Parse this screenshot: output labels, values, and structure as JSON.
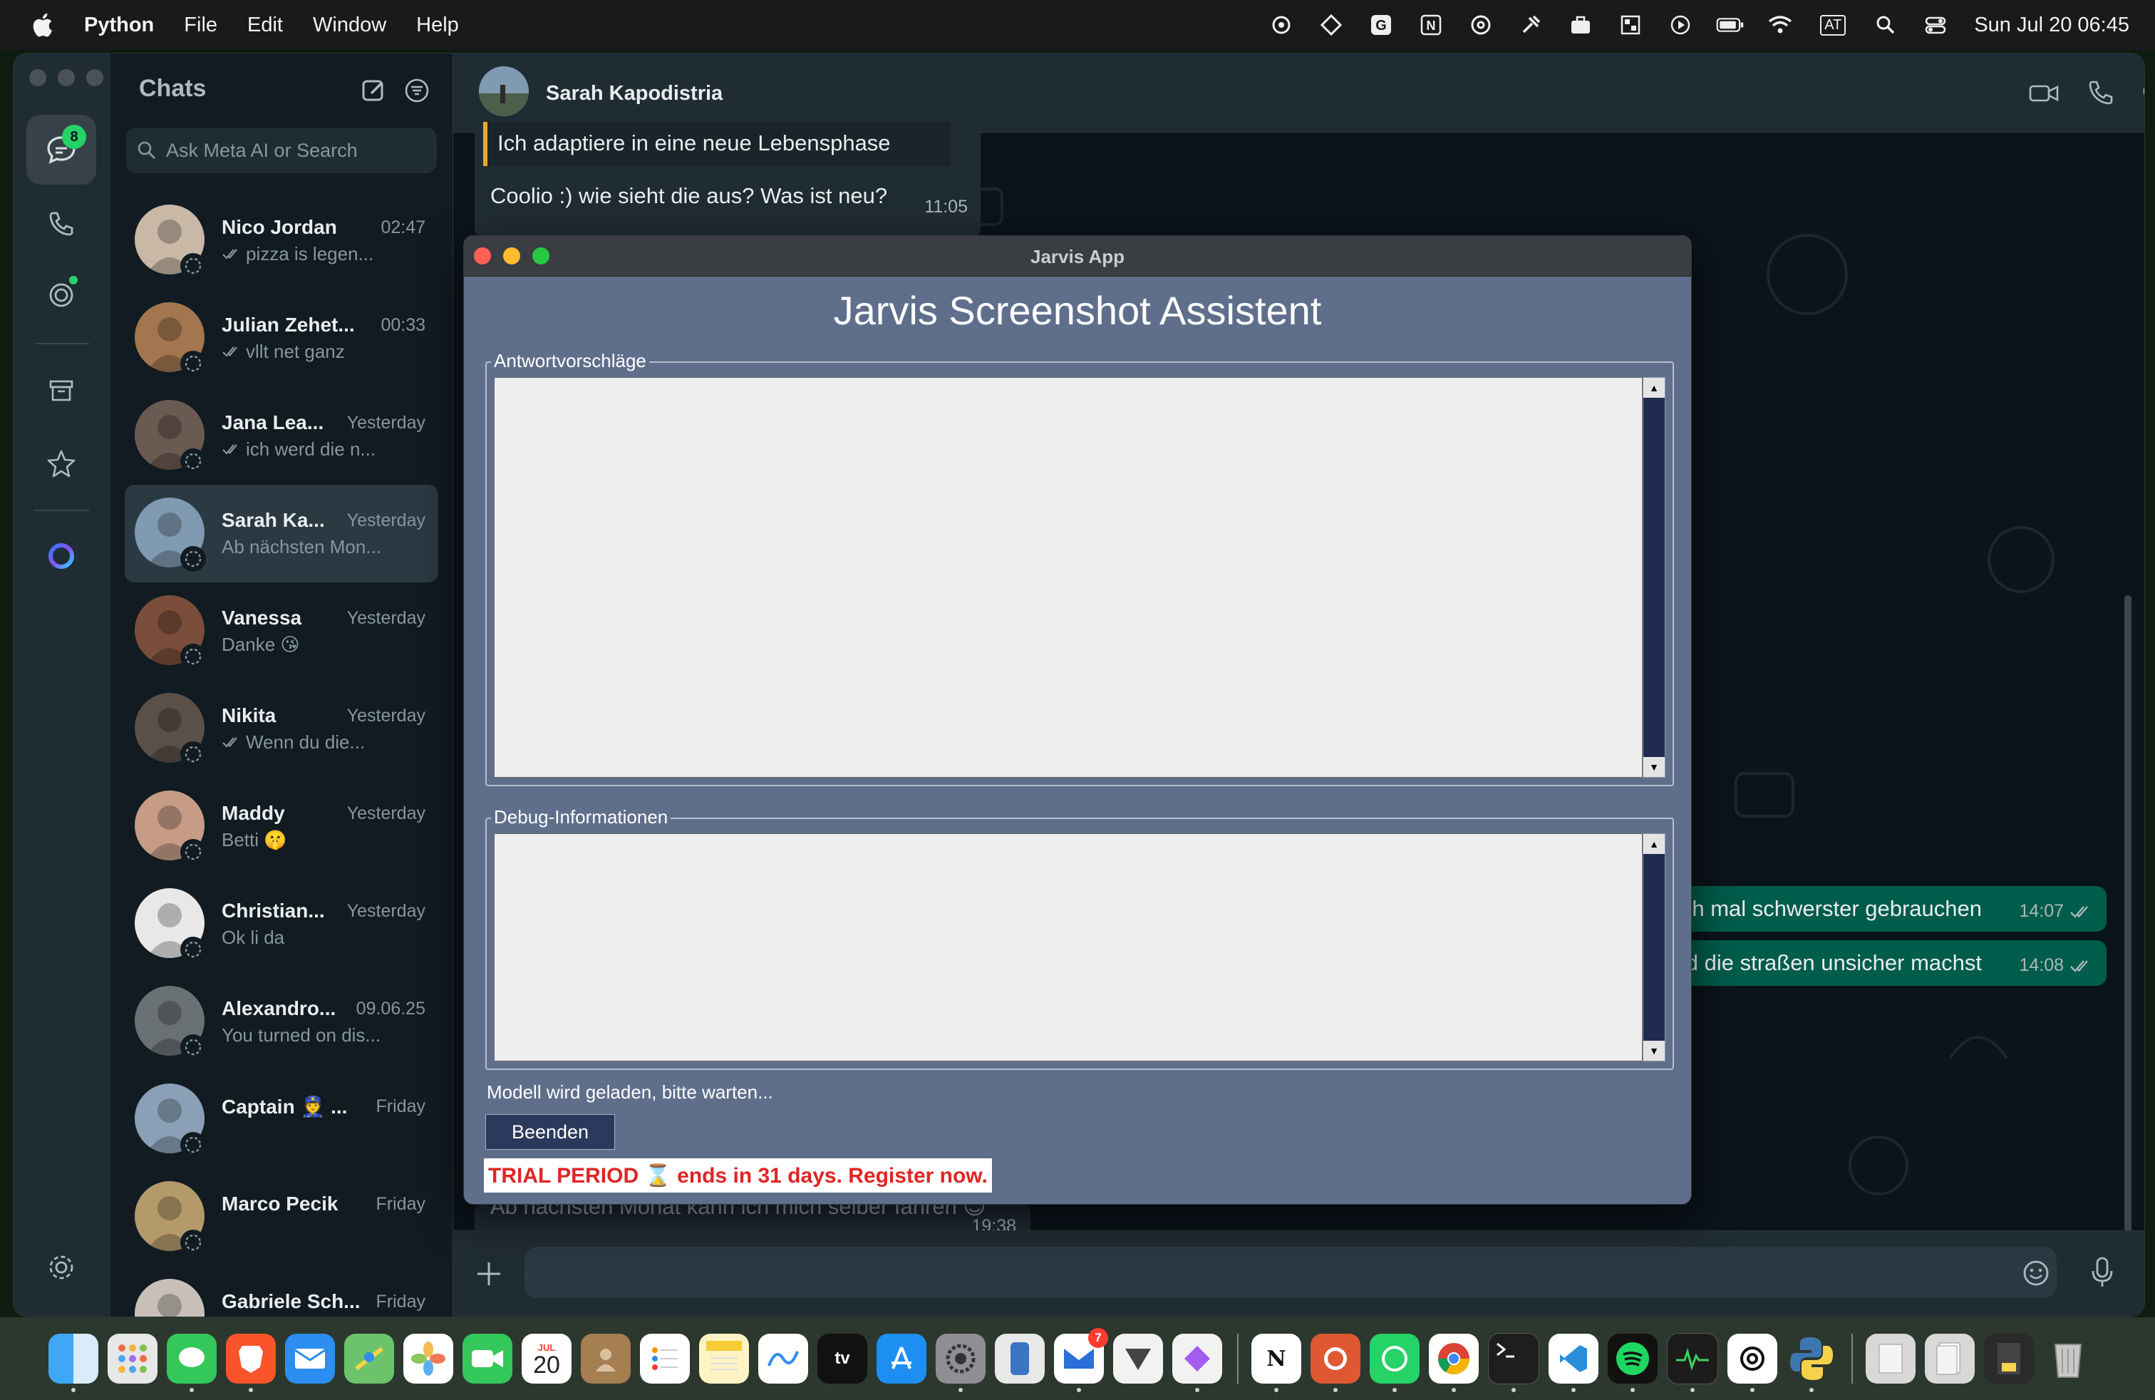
{
  "menubar": {
    "app_name": "Python",
    "menus": [
      "File",
      "Edit",
      "Window",
      "Help"
    ],
    "datetime": "Sun Jul 20  06:45",
    "keyboard_badge": "AT"
  },
  "whatsapp": {
    "chat_list_title": "Chats",
    "unread_badge": "8",
    "search_placeholder": "Ask Meta AI or Search",
    "chats": [
      {
        "name": "Nico Jordan",
        "time": "02:47",
        "preview": "pizza is legen...",
        "read_ticks": true,
        "avatar_color": "#c9b8a6"
      },
      {
        "name": "Julian Zehet...",
        "time": "00:33",
        "preview": "vllt net ganz",
        "read_ticks": true,
        "avatar_color": "#a3764f"
      },
      {
        "name": "Jana Lea...",
        "time": "Yesterday",
        "preview": "ich werd die n...",
        "read_ticks": true,
        "avatar_color": "#6b5a52"
      },
      {
        "name": "Sarah Ka...",
        "time": "Yesterday",
        "preview": "Ab nächsten Mon...",
        "read_ticks": false,
        "avatar_color": "#7f9ab1"
      },
      {
        "name": "Vanessa",
        "time": "Yesterday",
        "preview": "Danke 😘",
        "read_ticks": false,
        "avatar_color": "#7a4e3a"
      },
      {
        "name": "Nikita",
        "time": "Yesterday",
        "preview": "Wenn du die...",
        "read_ticks": true,
        "avatar_color": "#5a5048"
      },
      {
        "name": "Maddy",
        "time": "Yesterday",
        "preview": "Betti 🤫",
        "read_ticks": false,
        "avatar_color": "#c69c86"
      },
      {
        "name": "Christian...",
        "time": "Yesterday",
        "preview": "Ok li da",
        "read_ticks": false,
        "avatar_color": "#e8e8e8"
      },
      {
        "name": "Alexandro...",
        "time": "09.06.25",
        "preview": "You turned on dis...",
        "read_ticks": false,
        "avatar_color": "#6a7175"
      },
      {
        "name": "Captain 👮 ...",
        "time": "Friday",
        "preview": "",
        "read_ticks": false,
        "avatar_color": "#8aa0b6"
      },
      {
        "name": "Marco Pecik",
        "time": "Friday",
        "preview": "",
        "read_ticks": false,
        "avatar_color": "#b49a6a"
      },
      {
        "name": "Gabriele Sch...",
        "time": "Friday",
        "preview": "",
        "read_ticks": false,
        "avatar_color": "#c8c0b8"
      }
    ],
    "conversation": {
      "contact_name": "Sarah Kapodistria",
      "quoted_message": "Ich adaptiere in eine neue Lebensphase",
      "incoming_message": "Coolio :) wie sieht die aus? Was ist neu?",
      "incoming_time": "11:05",
      "outgoing_1": "chh mal schwerster gebrauchen",
      "outgoing_1_time": "14:07",
      "outgoing_2": "ld die straßen unsicher machst",
      "outgoing_2_time": "14:08",
      "partial_message": "Ab nächsten Monat kann ich mich selber fahren 😊",
      "partial_time": "19:38"
    }
  },
  "jarvis": {
    "window_title": "Jarvis App",
    "heading": "Jarvis Screenshot Assistent",
    "suggestions_label": "Antwortvorschläge",
    "debug_label": "Debug-Informationen",
    "status_text": "Modell wird geladen, bitte warten...",
    "quit_label": "Beenden",
    "trial_text": "TRIAL PERIOD ⌛ ends in 31 days. Register now."
  },
  "dock": {
    "calendar_month": "JUL",
    "calendar_day": "20",
    "mail_badge": "7",
    "tv_label": "tv"
  }
}
